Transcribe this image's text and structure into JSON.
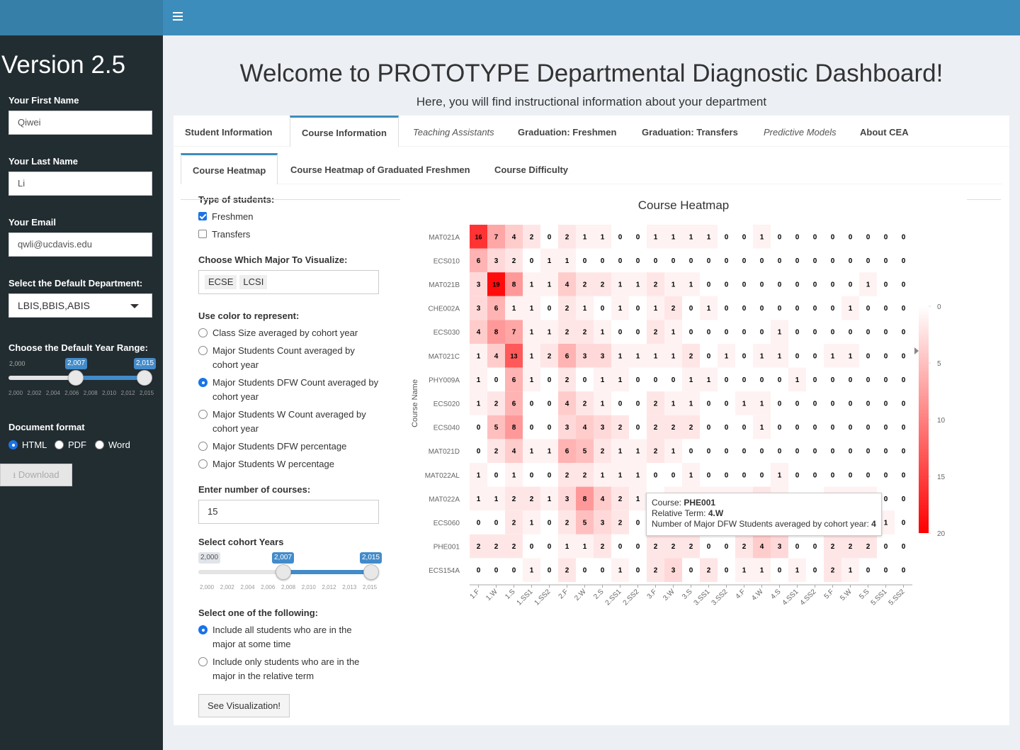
{
  "sidebar": {
    "version": "Version 2.5",
    "first_name_label": "Your First Name",
    "first_name_value": "Qiwei",
    "last_name_label": "Your Last Name",
    "last_name_value": "Li",
    "email_label": "Your Email",
    "email_value": "qwli@ucdavis.edu",
    "department_label": "Select the Default Department:",
    "department_value": "LBIS,BBIS,ABIS",
    "year_range_label": "Choose the Default Year Range:",
    "year_min_label": "2,000",
    "year_low": "2,007",
    "year_high": "2,015",
    "year_grid": [
      "2,000",
      "2,002",
      "2,004",
      "2,006",
      "2,008",
      "2,010",
      "2,012",
      "2,015"
    ],
    "doc_format_label": "Document format",
    "doc_formats": [
      "HTML",
      "PDF",
      "Word"
    ],
    "doc_format_selected": "HTML",
    "download_label": "Download"
  },
  "header": {
    "title": "Welcome to PROTOTYPE Departmental Diagnostic Dashboard!",
    "subtitle": "Here, you will find instructional information about your department"
  },
  "tabs": {
    "main": [
      "Student Information",
      "Course Information",
      "Teaching Assistants",
      "Graduation: Freshmen",
      "Graduation: Transfers",
      "Predictive Models",
      "About CEA"
    ],
    "main_active": "Course Information",
    "sub": [
      "Course Heatmap",
      "Course Heatmap of Graduated Freshmen",
      "Course Difficulty"
    ],
    "sub_active": "Course Heatmap"
  },
  "form": {
    "type_label": "Type of students:",
    "types": [
      {
        "label": "Freshmen",
        "checked": true
      },
      {
        "label": "Transfers",
        "checked": false
      }
    ],
    "major_label": "Choose Which Major To Visualize:",
    "majors": [
      "ECSE",
      "LCSI"
    ],
    "color_label": "Use color to represent:",
    "color_options": [
      {
        "line1": "Class Size averaged by cohort year",
        "line2": "",
        "selected": false
      },
      {
        "line1": "Major Students Count averaged by",
        "line2": "cohort year",
        "selected": false
      },
      {
        "line1": "Major Students DFW Count averaged by",
        "line2": "cohort year",
        "selected": true
      },
      {
        "line1": "Major Students W Count averaged by",
        "line2": "cohort year",
        "selected": false
      },
      {
        "line1": "Major Students DFW percentage",
        "line2": "",
        "selected": false
      },
      {
        "line1": "Major Students W percentage",
        "line2": "",
        "selected": false
      }
    ],
    "num_courses_label": "Enter number of courses:",
    "num_courses_value": "15",
    "cohort_label": "Select cohort Years",
    "cohort_min_label": "2,000",
    "cohort_low": "2,007",
    "cohort_high": "2,015",
    "cohort_grid": [
      "2,000",
      "2,002",
      "2,004",
      "2,006",
      "2,008",
      "2,010",
      "2,012",
      "2,013",
      "2,015"
    ],
    "select_label": "Select one of the following:",
    "select_options": [
      {
        "line1": "Include all students who are in the",
        "line2": "major at some time",
        "selected": true
      },
      {
        "line1": "Include only students who are in the",
        "line2": "major in the relative term",
        "selected": false
      }
    ],
    "button_label": "See Visualization!"
  },
  "chart_data": {
    "type": "heatmap",
    "title": "Course Heatmap",
    "ylabel": "Course Name",
    "xlabel": "",
    "x": [
      "1.F",
      "1.W",
      "1.S",
      "1.SS1",
      "1.SS2",
      "2.F",
      "2.W",
      "2.S",
      "2.SS1",
      "2.SS2",
      "3.F",
      "3.W",
      "3.S",
      "3.SS1",
      "3.SS2",
      "4.F",
      "4.W",
      "4.S",
      "4.SS1",
      "4.SS2",
      "5.F",
      "5.W",
      "5.S",
      "5.SS1",
      "5.SS2"
    ],
    "y": [
      "MAT021A",
      "ECS010",
      "MAT021B",
      "CHE002A",
      "ECS030",
      "MAT021C",
      "PHY009A",
      "ECS020",
      "ECS040",
      "MAT021D",
      "MAT022AL",
      "MAT022A",
      "ECS060",
      "PHE001",
      "ECS154A"
    ],
    "values": [
      [
        16,
        7,
        4,
        2,
        0,
        2,
        1,
        1,
        0,
        0,
        1,
        1,
        1,
        1,
        0,
        0,
        1,
        0,
        0,
        0,
        0,
        0,
        0,
        0,
        0
      ],
      [
        6,
        3,
        2,
        0,
        1,
        1,
        0,
        0,
        0,
        0,
        0,
        0,
        0,
        0,
        0,
        0,
        0,
        0,
        0,
        0,
        0,
        0,
        0,
        0,
        0
      ],
      [
        3,
        19,
        8,
        1,
        1,
        4,
        2,
        2,
        1,
        1,
        2,
        1,
        1,
        0,
        0,
        0,
        0,
        0,
        0,
        0,
        0,
        0,
        1,
        0,
        0
      ],
      [
        3,
        6,
        1,
        1,
        0,
        2,
        1,
        0,
        1,
        0,
        1,
        2,
        0,
        1,
        0,
        0,
        0,
        0,
        0,
        0,
        0,
        1,
        0,
        0,
        0
      ],
      [
        4,
        8,
        7,
        1,
        1,
        2,
        2,
        1,
        0,
        0,
        2,
        1,
        0,
        0,
        0,
        0,
        0,
        1,
        0,
        0,
        0,
        0,
        0,
        0,
        0
      ],
      [
        1,
        4,
        13,
        1,
        2,
        6,
        3,
        3,
        1,
        1,
        1,
        1,
        2,
        0,
        1,
        0,
        1,
        1,
        0,
        0,
        1,
        1,
        0,
        0,
        0
      ],
      [
        1,
        0,
        6,
        1,
        0,
        2,
        0,
        1,
        1,
        0,
        0,
        0,
        1,
        1,
        0,
        0,
        0,
        0,
        1,
        0,
        0,
        0,
        0,
        0,
        0
      ],
      [
        1,
        2,
        6,
        0,
        0,
        4,
        2,
        1,
        0,
        0,
        2,
        1,
        1,
        0,
        0,
        1,
        1,
        0,
        0,
        0,
        0,
        0,
        0,
        0,
        0
      ],
      [
        0,
        5,
        8,
        0,
        0,
        3,
        4,
        3,
        2,
        0,
        2,
        2,
        2,
        0,
        0,
        0,
        1,
        0,
        0,
        0,
        0,
        0,
        0,
        0,
        0
      ],
      [
        0,
        2,
        4,
        1,
        1,
        6,
        5,
        2,
        1,
        1,
        2,
        1,
        0,
        0,
        0,
        0,
        0,
        0,
        0,
        0,
        0,
        0,
        0,
        0,
        0
      ],
      [
        1,
        0,
        1,
        0,
        0,
        2,
        2,
        1,
        1,
        1,
        0,
        0,
        1,
        0,
        0,
        0,
        0,
        1,
        0,
        0,
        0,
        0,
        0,
        0,
        0
      ],
      [
        1,
        1,
        2,
        2,
        1,
        3,
        8,
        4,
        2,
        1,
        0,
        1,
        1,
        1,
        1,
        1,
        2,
        1,
        0,
        0,
        1,
        1,
        1,
        0,
        0
      ],
      [
        0,
        0,
        2,
        1,
        0,
        2,
        5,
        3,
        2,
        0,
        0,
        0,
        0,
        0,
        0,
        0,
        0,
        0,
        0,
        0,
        0,
        0,
        0,
        1,
        0
      ],
      [
        2,
        2,
        2,
        0,
        0,
        1,
        1,
        2,
        0,
        0,
        2,
        2,
        2,
        0,
        0,
        2,
        4,
        3,
        0,
        0,
        2,
        2,
        2,
        0,
        0
      ],
      [
        0,
        0,
        0,
        1,
        0,
        2,
        0,
        0,
        1,
        0,
        2,
        3,
        0,
        2,
        0,
        1,
        1,
        0,
        1,
        0,
        2,
        1,
        0,
        0,
        0
      ]
    ],
    "colorbar": {
      "min": 0,
      "max": 20,
      "ticks": [
        0,
        5,
        10,
        15,
        20
      ]
    },
    "colors": {
      "low": "#ffffff",
      "high": "#ff0000"
    },
    "tooltip": {
      "course_label": "Course:",
      "course": "PHE001",
      "term_label": "Relative Term:",
      "term": "4.W",
      "value_label": "Number of Major DFW Students averaged by cohort year:",
      "value": "4"
    }
  }
}
